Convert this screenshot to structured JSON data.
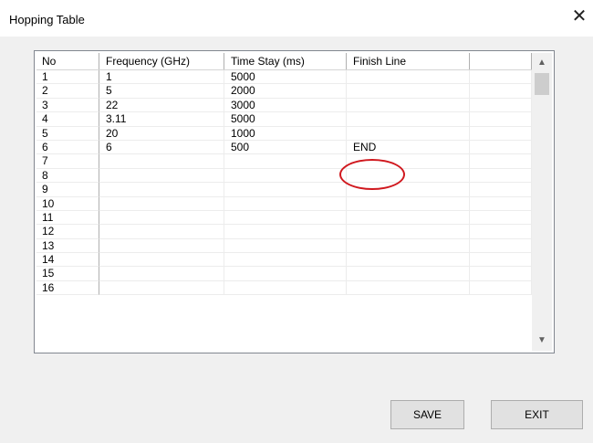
{
  "window": {
    "title": "Hopping Table",
    "close_glyph": "✕"
  },
  "table": {
    "columns": [
      "No",
      "Frequency (GHz)",
      "Time Stay (ms)",
      "Finish Line",
      ""
    ],
    "rows": [
      [
        "1",
        "1",
        "5000",
        "",
        ""
      ],
      [
        "2",
        "5",
        "2000",
        "",
        ""
      ],
      [
        "3",
        "22",
        "3000",
        "",
        ""
      ],
      [
        "4",
        "3.11",
        "5000",
        "",
        ""
      ],
      [
        "5",
        "20",
        "1000",
        "",
        ""
      ],
      [
        "6",
        "6",
        "500",
        "END",
        ""
      ],
      [
        "7",
        "",
        "",
        "",
        ""
      ],
      [
        "8",
        "",
        "",
        "",
        ""
      ],
      [
        "9",
        "",
        "",
        "",
        ""
      ],
      [
        "10",
        "",
        "",
        "",
        ""
      ],
      [
        "11",
        "",
        "",
        "",
        ""
      ],
      [
        "12",
        "",
        "",
        "",
        ""
      ],
      [
        "13",
        "",
        "",
        "",
        ""
      ],
      [
        "14",
        "",
        "",
        "",
        ""
      ],
      [
        "15",
        "",
        "",
        "",
        ""
      ],
      [
        "16",
        "",
        "",
        "",
        ""
      ]
    ]
  },
  "scrollbar": {
    "up_glyph": "▲",
    "down_glyph": "▼"
  },
  "buttons": {
    "save": "SAVE",
    "exit": "EXIT"
  },
  "annotation": {
    "color": "#d0181e",
    "target": "END"
  }
}
